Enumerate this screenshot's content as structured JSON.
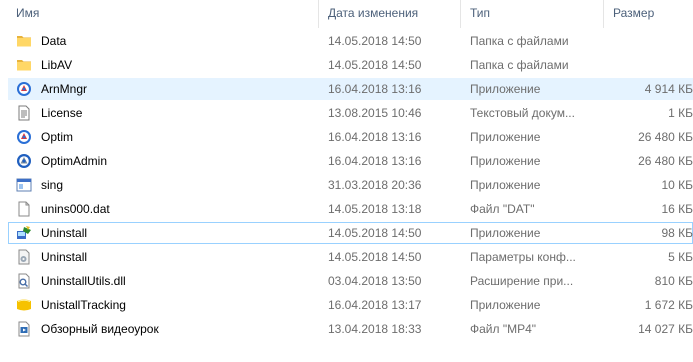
{
  "columns": {
    "name": "Имя",
    "date": "Дата изменения",
    "type": "Тип",
    "size": "Размер"
  },
  "files": [
    {
      "icon": "folder-icon",
      "name": "Data",
      "date": "14.05.2018 14:50",
      "type": "Папка с файлами",
      "size": ""
    },
    {
      "icon": "folder-icon",
      "name": "LibAV",
      "date": "14.05.2018 14:50",
      "type": "Папка с файлами",
      "size": ""
    },
    {
      "icon": "app-optim-icon",
      "name": "ArnMngr",
      "date": "16.04.2018 13:16",
      "type": "Приложение",
      "size": "4 914 КБ"
    },
    {
      "icon": "text-document-icon",
      "name": "License",
      "date": "13.08.2015 10:46",
      "type": "Текстовый докум...",
      "size": "1 КБ"
    },
    {
      "icon": "app-optim-icon",
      "name": "Optim",
      "date": "16.04.2018 13:16",
      "type": "Приложение",
      "size": "26 480 КБ"
    },
    {
      "icon": "app-optimadmin-icon",
      "name": "OptimAdmin",
      "date": "16.04.2018 13:16",
      "type": "Приложение",
      "size": "26 480 КБ"
    },
    {
      "icon": "app-window-icon",
      "name": "sing",
      "date": "31.03.2018 20:36",
      "type": "Приложение",
      "size": "10 КБ"
    },
    {
      "icon": "blank-file-icon",
      "name": "unins000.dat",
      "date": "14.05.2018 13:18",
      "type": "Файл \"DAT\"",
      "size": "16 КБ"
    },
    {
      "icon": "uninstall-icon",
      "name": "Uninstall",
      "date": "14.05.2018 14:50",
      "type": "Приложение",
      "size": "98 КБ"
    },
    {
      "icon": "config-file-icon",
      "name": "Uninstall",
      "date": "14.05.2018 14:50",
      "type": "Параметры конф...",
      "size": "5 КБ"
    },
    {
      "icon": "dll-file-icon",
      "name": "UninstallUtils.dll",
      "date": "03.04.2018 13:50",
      "type": "Расширение при...",
      "size": "810 КБ"
    },
    {
      "icon": "yellow-app-icon",
      "name": "UnistallTracking",
      "date": "16.04.2018 13:17",
      "type": "Приложение",
      "size": "1 672 КБ"
    },
    {
      "icon": "video-file-icon",
      "name": "Обзорный видеоурок",
      "date": "13.04.2018 18:33",
      "type": "Файл \"MP4\"",
      "size": "14 027 КБ"
    }
  ],
  "selected_row": 8,
  "hover_row": 2
}
